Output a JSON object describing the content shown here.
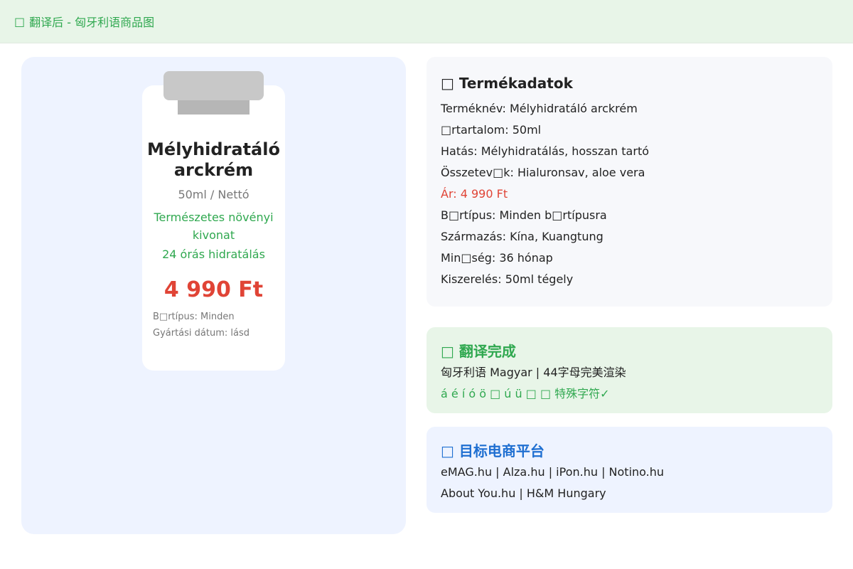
{
  "header": {
    "icon": "□",
    "title": "翻译后 - 匈牙利语商品图"
  },
  "product_image": {
    "name": "Mélyhidratáló arckrém",
    "size": "50ml / Nettó",
    "feature_1": "Természetes növényi kivonat",
    "feature_2": "24 órás hidratálás",
    "price": "4 990 Ft",
    "skin_type": "B□rtípus: Minden",
    "date": "Gyártási dátum: lásd"
  },
  "info_card": {
    "icon": "□",
    "title": "Termékadatok",
    "lines": [
      "Terméknév: Mélyhidratáló arckrém",
      "□rtartalom: 50ml",
      "Hatás: Mélyhidratálás, hosszan tartó",
      "Összetev□k: Hialuronsav, aloe vera",
      "Ár: 4 990 Ft",
      "B□rtípus: Minden b□rtípusra",
      "Származás: Kína, Kuangtung",
      "Min□ség: 36 hónap",
      "Kiszerelés: 50ml tégely"
    ]
  },
  "status_card": {
    "icon": "□",
    "title": "翻译完成",
    "line_1": "匈牙利语 Magyar | 44字母完美渲染",
    "line_2": "á é í ó ö □ ú ü □ □ 特殊字符✓"
  },
  "platform_card": {
    "icon": "□",
    "title": "目标电商平台",
    "line_1": "eMAG.hu | Alza.hu | iPon.hu | Notino.hu",
    "line_2": "About You.hu | H&M Hungary"
  },
  "colors": {
    "accent_green": "#2fa84f",
    "accent_red": "#e04436",
    "accent_blue": "#1f6fd1"
  }
}
